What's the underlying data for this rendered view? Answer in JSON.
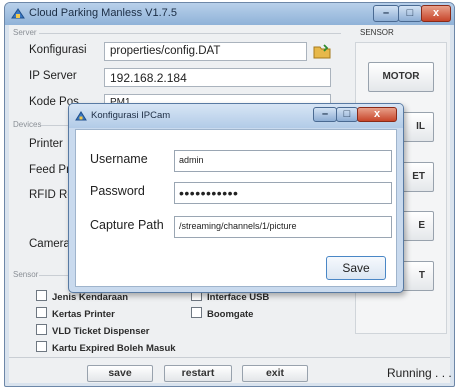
{
  "window": {
    "title": "Cloud Parking Manless V1.7.5",
    "min_glyph": "–",
    "max_glyph": "□",
    "close_glyph": "x"
  },
  "sections": {
    "server": "Server",
    "devices": "Devices",
    "sensor_left": "Sensor",
    "sensor_right": "SENSOR"
  },
  "server": {
    "konfigurasi_label": "Konfigurasi",
    "konfigurasi_value": "properties/config.DAT",
    "ip_label": "IP Server",
    "ip_value": "192.168.2.184",
    "kode_pos_label": "Kode Pos",
    "kode_pos_value": "PM1"
  },
  "devices": {
    "printer_label": "Printer",
    "feed_label": "Feed Pr",
    "rfid_label": "RFID Re",
    "camera_label": "Camera"
  },
  "sensor_checks": [
    {
      "label": "Jenis Kendaraan"
    },
    {
      "label": "Interface USB"
    },
    {
      "label": "Kertas Printer"
    },
    {
      "label": "Boomgate"
    },
    {
      "label": "VLD Ticket Dispenser"
    },
    {
      "label": "Kartu Expired Boleh Masuk"
    }
  ],
  "side_buttons": [
    {
      "label": "MOTOR"
    },
    {
      "label": "IL"
    },
    {
      "label": "ET"
    },
    {
      "label": "E"
    },
    {
      "label": "T"
    }
  ],
  "bottom": {
    "save": "save",
    "restart": "restart",
    "exit": "exit",
    "status": "Running . . ."
  },
  "dialog": {
    "title": "Konfigurasi IPCam",
    "username_label": "Username",
    "username_value": "admin",
    "password_label": "Password",
    "password_value": "•••••••••••",
    "capture_label": "Capture Path",
    "capture_value": "/streaming/channels/1/picture",
    "save_button": "Save",
    "min_glyph": "–",
    "max_glyph": "□",
    "close_glyph": "x"
  }
}
